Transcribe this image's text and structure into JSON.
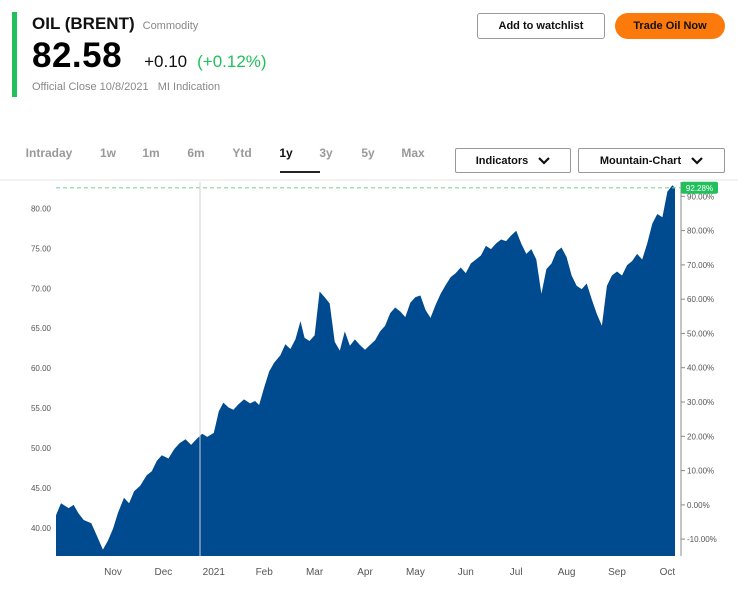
{
  "quote": {
    "name": "OIL (BRENT)",
    "category": "Commodity",
    "price": "82.58",
    "change": "+0.10",
    "change_pct": "(+0.12%)",
    "close_label": "Official Close 10/8/2021",
    "indication": "MI Indication",
    "accent_color": "#21c05c"
  },
  "actions": {
    "watchlist_label": "Add to watchlist",
    "trade_label": "Trade Oil Now",
    "trade_color": "#fb7a0b"
  },
  "tabs": [
    {
      "label": "Intraday",
      "active": false
    },
    {
      "label": "1w",
      "active": false
    },
    {
      "label": "1m",
      "active": false
    },
    {
      "label": "6m",
      "active": false
    },
    {
      "label": "Ytd",
      "active": false
    },
    {
      "label": "1y",
      "active": true
    },
    {
      "label": "3y",
      "active": false
    },
    {
      "label": "5y",
      "active": false
    },
    {
      "label": "Max",
      "active": false
    }
  ],
  "controls": {
    "indicators_label": "Indicators",
    "chart_type_label": "Mountain-Chart"
  },
  "chart_data": {
    "type": "area",
    "fill_color": "#004a8f",
    "x_labels": [
      "Nov",
      "Dec",
      "2021",
      "Feb",
      "Mar",
      "Apr",
      "May",
      "Jun",
      "Jul",
      "Aug",
      "Sep",
      "Oct"
    ],
    "x_label_pos": [
      1.13,
      2.13,
      3.13,
      4.13,
      5.13,
      6.13,
      7.13,
      8.13,
      9.13,
      10.13,
      11.13,
      12.13
    ],
    "x_range": [
      0,
      12.4
    ],
    "ylim_left": [
      36.5,
      83.3
    ],
    "left_ticks": [
      "40.00",
      "45.00",
      "50.00",
      "55.00",
      "60.00",
      "65.00",
      "70.00",
      "75.00",
      "80.00"
    ],
    "right_ticks": [
      "-10.00%",
      "0.00%",
      "10.00%",
      "20.00%",
      "30.00%",
      "40.00%",
      "50.00%",
      "60.00%",
      "70.00%",
      "80.00%",
      "90.00%"
    ],
    "right_ref_price": 42.9,
    "last_change_badge": "92.28%",
    "reference_line_value": 82.58,
    "grid": false,
    "values": [
      [
        0.0,
        41.6
      ],
      [
        0.1,
        43.1
      ],
      [
        0.25,
        42.5
      ],
      [
        0.35,
        42.9
      ],
      [
        0.45,
        41.8
      ],
      [
        0.55,
        41.0
      ],
      [
        0.7,
        40.6
      ],
      [
        0.82,
        38.9
      ],
      [
        0.93,
        37.3
      ],
      [
        1.03,
        38.4
      ],
      [
        1.13,
        39.9
      ],
      [
        1.23,
        41.9
      ],
      [
        1.35,
        43.8
      ],
      [
        1.45,
        43.1
      ],
      [
        1.55,
        44.6
      ],
      [
        1.67,
        45.3
      ],
      [
        1.8,
        46.6
      ],
      [
        1.9,
        47.1
      ],
      [
        2.0,
        48.4
      ],
      [
        2.1,
        49.1
      ],
      [
        2.23,
        48.7
      ],
      [
        2.35,
        49.9
      ],
      [
        2.45,
        50.6
      ],
      [
        2.57,
        51.1
      ],
      [
        2.68,
        50.4
      ],
      [
        2.8,
        51.2
      ],
      [
        2.9,
        51.8
      ],
      [
        3.0,
        51.4
      ],
      [
        3.13,
        51.9
      ],
      [
        3.23,
        54.6
      ],
      [
        3.32,
        55.7
      ],
      [
        3.42,
        55.1
      ],
      [
        3.52,
        54.8
      ],
      [
        3.62,
        55.5
      ],
      [
        3.73,
        56.1
      ],
      [
        3.85,
        55.6
      ],
      [
        3.95,
        55.9
      ],
      [
        4.03,
        55.4
      ],
      [
        4.13,
        57.6
      ],
      [
        4.23,
        59.6
      ],
      [
        4.33,
        60.7
      ],
      [
        4.45,
        61.6
      ],
      [
        4.55,
        63.0
      ],
      [
        4.65,
        62.4
      ],
      [
        4.75,
        63.6
      ],
      [
        4.85,
        65.9
      ],
      [
        4.93,
        63.8
      ],
      [
        5.03,
        63.4
      ],
      [
        5.13,
        64.1
      ],
      [
        5.23,
        69.6
      ],
      [
        5.33,
        68.9
      ],
      [
        5.43,
        68.1
      ],
      [
        5.53,
        63.3
      ],
      [
        5.63,
        62.2
      ],
      [
        5.73,
        64.6
      ],
      [
        5.83,
        62.8
      ],
      [
        5.93,
        63.6
      ],
      [
        6.03,
        62.9
      ],
      [
        6.13,
        62.3
      ],
      [
        6.23,
        62.9
      ],
      [
        6.33,
        63.5
      ],
      [
        6.43,
        64.6
      ],
      [
        6.53,
        65.3
      ],
      [
        6.63,
        66.9
      ],
      [
        6.73,
        67.6
      ],
      [
        6.83,
        67.1
      ],
      [
        6.93,
        66.4
      ],
      [
        7.03,
        68.2
      ],
      [
        7.13,
        68.9
      ],
      [
        7.23,
        69.1
      ],
      [
        7.33,
        67.3
      ],
      [
        7.43,
        66.3
      ],
      [
        7.53,
        67.9
      ],
      [
        7.63,
        69.3
      ],
      [
        7.73,
        70.4
      ],
      [
        7.83,
        71.4
      ],
      [
        7.93,
        71.9
      ],
      [
        8.03,
        72.6
      ],
      [
        8.13,
        71.9
      ],
      [
        8.23,
        73.1
      ],
      [
        8.33,
        73.6
      ],
      [
        8.43,
        74.1
      ],
      [
        8.53,
        75.3
      ],
      [
        8.63,
        74.9
      ],
      [
        8.73,
        75.6
      ],
      [
        8.83,
        76.1
      ],
      [
        8.93,
        75.9
      ],
      [
        9.03,
        76.6
      ],
      [
        9.13,
        77.2
      ],
      [
        9.23,
        75.6
      ],
      [
        9.33,
        74.3
      ],
      [
        9.43,
        74.9
      ],
      [
        9.53,
        73.6
      ],
      [
        9.63,
        69.3
      ],
      [
        9.73,
        72.4
      ],
      [
        9.83,
        73.1
      ],
      [
        9.93,
        74.6
      ],
      [
        10.03,
        75.1
      ],
      [
        10.13,
        73.9
      ],
      [
        10.23,
        71.6
      ],
      [
        10.33,
        70.3
      ],
      [
        10.43,
        69.9
      ],
      [
        10.53,
        70.6
      ],
      [
        10.63,
        68.6
      ],
      [
        10.73,
        66.8
      ],
      [
        10.83,
        65.3
      ],
      [
        10.93,
        70.3
      ],
      [
        11.03,
        71.6
      ],
      [
        11.13,
        72.1
      ],
      [
        11.23,
        71.6
      ],
      [
        11.33,
        72.9
      ],
      [
        11.43,
        73.4
      ],
      [
        11.53,
        74.3
      ],
      [
        11.63,
        73.6
      ],
      [
        11.73,
        75.6
      ],
      [
        11.83,
        78.1
      ],
      [
        11.93,
        79.3
      ],
      [
        12.03,
        78.9
      ],
      [
        12.13,
        82.1
      ],
      [
        12.23,
        82.9
      ],
      [
        12.28,
        82.58
      ]
    ]
  }
}
